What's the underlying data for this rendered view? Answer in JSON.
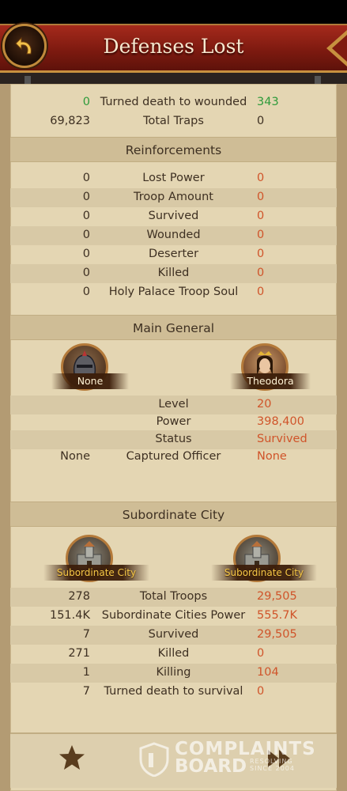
{
  "header": {
    "title": "Defenses Lost"
  },
  "top_rows": [
    {
      "left": "0",
      "label": "Turned death to wounded",
      "right": "343"
    },
    {
      "left": "69,823",
      "label": "Total Traps",
      "right": "0"
    }
  ],
  "reinforcements": {
    "title": "Reinforcements",
    "rows": [
      {
        "left": "0",
        "label": "Lost Power",
        "right": "0"
      },
      {
        "left": "0",
        "label": "Troop Amount",
        "right": "0"
      },
      {
        "left": "0",
        "label": "Survived",
        "right": "0"
      },
      {
        "left": "0",
        "label": "Wounded",
        "right": "0"
      },
      {
        "left": "0",
        "label": "Deserter",
        "right": "0"
      },
      {
        "left": "0",
        "label": "Killed",
        "right": "0"
      },
      {
        "left": "0",
        "label": "Holy Palace Troop Soul",
        "right": "0"
      }
    ]
  },
  "main_general": {
    "title": "Main General",
    "left_name": "None",
    "right_name": "Theodora",
    "rows": [
      {
        "left": "",
        "label": "Level",
        "right": "20"
      },
      {
        "left": "",
        "label": "Power",
        "right": "398,400"
      },
      {
        "left": "",
        "label": "Status",
        "right": "Survived"
      },
      {
        "left": "None",
        "label": "Captured Officer",
        "right": "None"
      }
    ]
  },
  "subordinate_city": {
    "title": "Subordinate City",
    "left_name": "Subordinate City",
    "right_name": "Subordinate City",
    "rows": [
      {
        "left": "278",
        "label": "Total Troops",
        "right": "29,505"
      },
      {
        "left": "151.4K",
        "label": "Subordinate Cities Power",
        "right": "555.7K"
      },
      {
        "left": "7",
        "label": "Survived",
        "right": "29,505"
      },
      {
        "left": "271",
        "label": "Killed",
        "right": "0"
      },
      {
        "left": "1",
        "label": "Killing",
        "right": "104"
      },
      {
        "left": "7",
        "label": "Turned death to survival",
        "right": "0"
      }
    ]
  },
  "watermark": {
    "line1": "COMPLAINTS",
    "line2": "BOARD",
    "line3": "RESOLVING",
    "line4": "SINCE 2004"
  },
  "colors": {
    "header_red": "#8e1f14",
    "accent_orange": "#d0542a",
    "accent_green": "#2d9a3a",
    "panel": "#e4d6b3"
  },
  "icons": [
    "back-arrow-icon",
    "star-icon",
    "fast-forward-icon"
  ]
}
